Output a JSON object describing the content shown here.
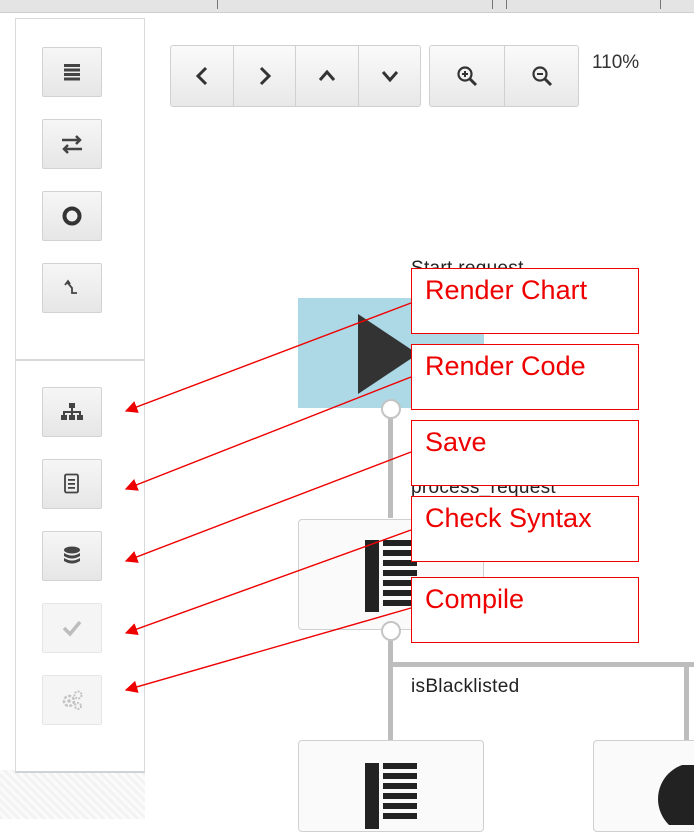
{
  "sidebar": {
    "top_buttons": [
      {
        "icon": "list-icon"
      },
      {
        "icon": "swap-arrows-icon"
      },
      {
        "icon": "stop-circle-icon"
      },
      {
        "icon": "branch-icon"
      }
    ],
    "bottom_buttons": [
      {
        "icon": "hierarchy-icon",
        "enabled": true
      },
      {
        "icon": "document-icon",
        "enabled": true
      },
      {
        "icon": "database-icon",
        "enabled": true
      },
      {
        "icon": "checkmark-icon",
        "enabled": false
      },
      {
        "icon": "gears-icon",
        "enabled": false
      }
    ]
  },
  "toolbar": {
    "navigation": [
      "chevron-left-icon",
      "chevron-right-icon",
      "chevron-up-icon",
      "chevron-down-icon"
    ],
    "zoom_controls": [
      "zoom-in-icon",
      "zoom-out-icon"
    ],
    "zoom_level": "110%"
  },
  "flowchart": {
    "start_label": "Start request",
    "process_label": "process_request",
    "decision_label": "isBlacklisted",
    "colors": {
      "start_fill": "#add8e6",
      "connector": "#bdbdbd",
      "glyph": "#222222"
    }
  },
  "annotations": {
    "color": "#ee0000",
    "callouts": [
      {
        "label": "Render Chart",
        "target": "hierarchy-icon"
      },
      {
        "label": "Render Code",
        "target": "document-icon"
      },
      {
        "label": "Save",
        "target": "database-icon"
      },
      {
        "label": "Check Syntax",
        "target": "checkmark-icon"
      },
      {
        "label": "Compile",
        "target": "gears-icon"
      }
    ]
  }
}
